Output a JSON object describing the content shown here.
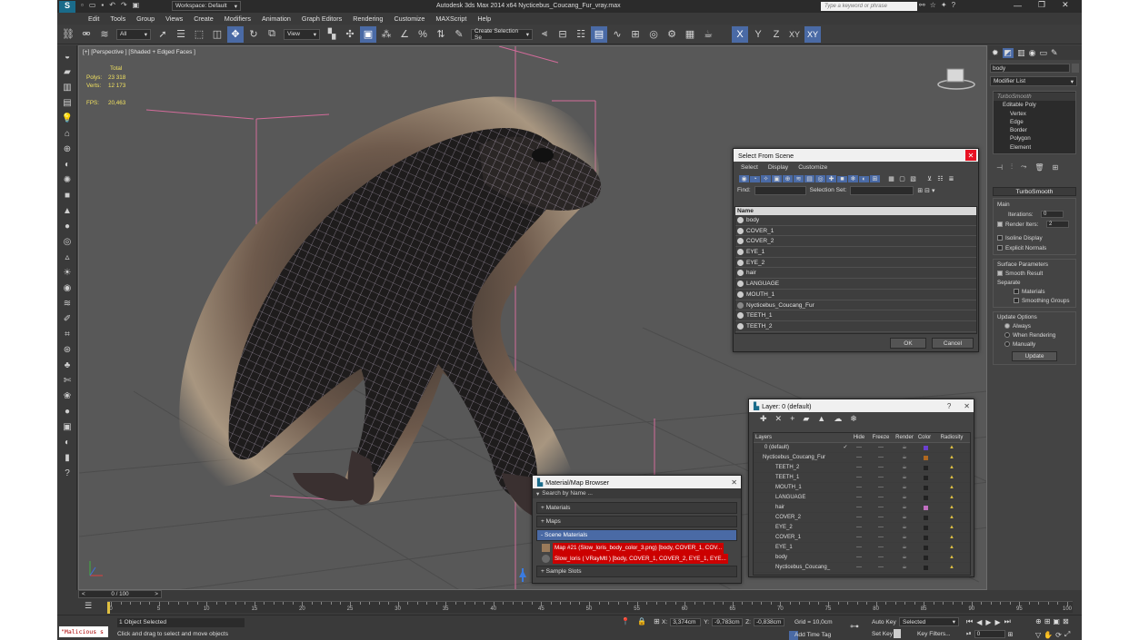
{
  "app": {
    "title": "Autodesk 3ds Max  2014 x64     Nycticebus_Coucang_Fur_vray.max",
    "workspace": "Workspace: Default",
    "search_placeholder": "Type a keyword or phrase"
  },
  "menu": [
    "Edit",
    "Tools",
    "Group",
    "Views",
    "Create",
    "Modifiers",
    "Animation",
    "Graph Editors",
    "Rendering",
    "Customize",
    "MAXScript",
    "Help"
  ],
  "toolbar": {
    "selection_filter": "All",
    "ref_coord": "View",
    "named_selection": "Create Selection Se",
    "axis": [
      "X",
      "Y",
      "Z",
      "XY",
      "XY"
    ]
  },
  "viewport": {
    "label": "[+] [Perspective ] [Shaded + Edged Faces ]",
    "stats": {
      "total_label": "Total",
      "polys_label": "Polys:",
      "polys": "23 318",
      "verts_label": "Verts:",
      "verts": "12 173",
      "fps_label": "FPS:",
      "fps": "20,463"
    },
    "axis_labels": {
      "x": "x",
      "y": "y",
      "z": "z"
    }
  },
  "command_panel": {
    "object_name": "body",
    "modifier_list": "Modifier List",
    "stack": [
      "TurboSmooth",
      "Editable Poly",
      "Vertex",
      "Edge",
      "Border",
      "Polygon",
      "Element"
    ],
    "turbosmooth": {
      "title": "TurboSmooth",
      "main": "Main",
      "iterations_label": "Iterations:",
      "iterations": "0",
      "render_iters_label": "Render Iters:",
      "render_iters": "2",
      "isoline": "Isoline Display",
      "explicit_normals": "Explicit Normals",
      "surface_params": "Surface Parameters",
      "smooth_result": "Smooth Result",
      "separate": "Separate",
      "materials": "Materials",
      "smoothing_groups": "Smoothing Groups",
      "update_options": "Update Options",
      "always": "Always",
      "when_rendering": "When Rendering",
      "manually": "Manually",
      "update_btn": "Update"
    }
  },
  "select_from_scene": {
    "title": "Select From Scene",
    "menu": [
      "Select",
      "Display",
      "Customize"
    ],
    "find_label": "Find:",
    "selection_set_label": "Selection Set:",
    "column": "Name",
    "items": [
      "body",
      "COVER_1",
      "COVER_2",
      "EYE_1",
      "EYE_2",
      "hair",
      "LANGUAGE",
      "MOUTH_1",
      "Nycticebus_Coucang_Fur",
      "TEETH_1",
      "TEETH_2"
    ],
    "ok": "OK",
    "cancel": "Cancel"
  },
  "layer_dialog": {
    "title": "Layer: 0 (default)",
    "help": "?",
    "columns": [
      "Layers",
      "Hide",
      "Freeze",
      "Render",
      "Color",
      "Radiosity"
    ],
    "rows": [
      {
        "name": "0 (default)",
        "color": "#6a3fd0"
      },
      {
        "name": "Nycticebus_Coucang_Fur",
        "color": "#b06820"
      },
      {
        "name": "TEETH_2",
        "color": "#222222"
      },
      {
        "name": "TEETH_1",
        "color": "#222222"
      },
      {
        "name": "MOUTH_1",
        "color": "#222222"
      },
      {
        "name": "LANGUAGE",
        "color": "#222222"
      },
      {
        "name": "hair",
        "color": "#c070c0"
      },
      {
        "name": "COVER_2",
        "color": "#222222"
      },
      {
        "name": "EYE_2",
        "color": "#222222"
      },
      {
        "name": "COVER_1",
        "color": "#222222"
      },
      {
        "name": "EYE_1",
        "color": "#222222"
      },
      {
        "name": "body",
        "color": "#222222"
      },
      {
        "name": "Nycticebus_Coucang_",
        "color": "#222222"
      }
    ]
  },
  "material_browser": {
    "title": "Material/Map Browser",
    "search": "Search by Name ...",
    "sections": [
      "+ Materials",
      "+ Maps",
      "- Scene Materials",
      "+ Sample Slots"
    ],
    "entries": [
      "Map #21 (Slow_loris_body_color_3.png) [body, COVER_1, COV...",
      "Slow_loris  ( VRayMtl ) [body, COVER_1, COVER_2, EYE_1, EYE..."
    ]
  },
  "timeline": {
    "frame": "0 / 100",
    "ticks": [
      "0",
      "5",
      "10",
      "15",
      "20",
      "25",
      "30",
      "35",
      "40",
      "45",
      "50",
      "55",
      "60",
      "65",
      "70",
      "75",
      "80",
      "85",
      "90",
      "95",
      "100"
    ]
  },
  "status": {
    "maxscript": "\"Malicious s",
    "selected": "1 Object Selected",
    "prompt": "Click and drag to select and move objects",
    "x_label": "X:",
    "x": "3,374cm",
    "y_label": "Y:",
    "y": "-9,783cm",
    "z_label": "Z:",
    "z": "-0,838cm",
    "grid": "Grid = 10,0cm",
    "add_time_tag": "Add Time Tag",
    "auto_key": "Auto Key",
    "selected_dd": "Selected",
    "set_key": "Set Key",
    "key_filters": "Key Filters...",
    "frame_field": "0"
  }
}
